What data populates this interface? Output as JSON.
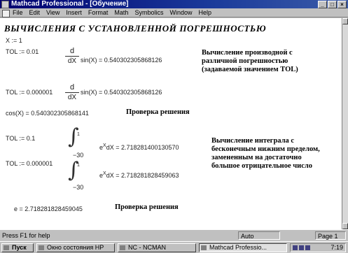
{
  "window": {
    "title": "Mathcad Professional - [Обучение]",
    "controls": [
      "_",
      "□",
      "×"
    ]
  },
  "menu": [
    "File",
    "Edit",
    "View",
    "Insert",
    "Format",
    "Math",
    "Symbolics",
    "Window",
    "Help"
  ],
  "worksheet": {
    "heading": "ВЫЧИСЛЕНИЯ С УСТАНОВЛЕННОЙ ПОГРЕШНОСТЬЮ",
    "x_assign": "X := 1",
    "tol1": "TOL := 0.01",
    "tol2": "TOL := 0.000001",
    "d_num": "d",
    "d_den": "dX",
    "deriv_expr1": "sin(X) = 0.540302305868126",
    "deriv_expr2": "sin(X) = 0.540302305868126",
    "comment_deriv": "Вычисление производной с различной погрешностью (задаваемой значением TOL)",
    "cos_check": "cos(X) = 0.540302305868141",
    "check_label1": "Проверка решения",
    "tol3": "TOL := 0.1",
    "tol4": "TOL := 0.000001",
    "int_upper1": "1",
    "int_lower1": "−30",
    "int_expr1": "e",
    "int_sup1": "X",
    "int_rest1": "dX = 2.718281400130570",
    "int_upper2": "1",
    "int_lower2": "−30",
    "int_expr2": "e",
    "int_sup2": "X",
    "int_rest2": "dX = 2.718281828459063",
    "comment_int": "Вычисление интеграла с бесконечным нижним пределом, замененным на достаточно большое отрицательное число",
    "e_value": "e = 2.718281828459045",
    "check_label2": "Проверка решения"
  },
  "statusbar": {
    "help": "Press F1 for help",
    "mode": "Auto",
    "page": "Page 1"
  },
  "taskbar": {
    "start": "Пуск",
    "tasks": [
      "Окно состояния HP",
      "NC - NCMAN",
      "Mathcad Professio..."
    ],
    "clock": "7:19"
  },
  "colors": {
    "title_bar": "#000070",
    "window_face": "#c0c0c0",
    "worksheet_bg": "#ffffff"
  }
}
